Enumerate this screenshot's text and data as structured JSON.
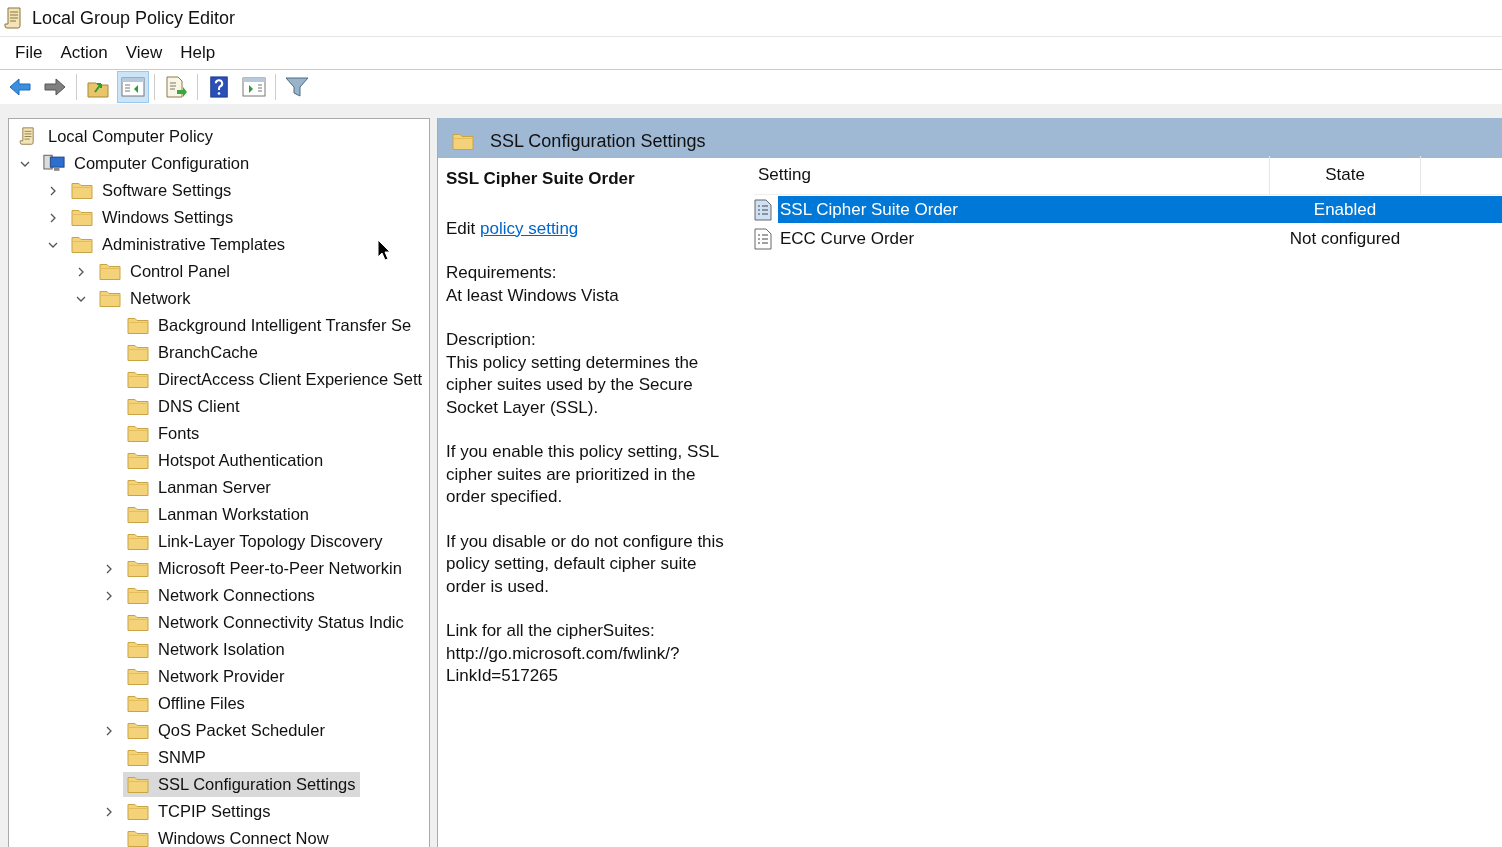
{
  "window": {
    "title": "Local Group Policy Editor"
  },
  "menu": [
    "File",
    "Action",
    "View",
    "Help"
  ],
  "toolbar": [
    {
      "kind": "back",
      "pressed": false
    },
    {
      "kind": "forward",
      "pressed": false
    },
    {
      "kind": "sep"
    },
    {
      "kind": "up",
      "pressed": false
    },
    {
      "kind": "tree",
      "pressed": true
    },
    {
      "kind": "sep"
    },
    {
      "kind": "export",
      "pressed": false
    },
    {
      "kind": "sep"
    },
    {
      "kind": "help",
      "pressed": false
    },
    {
      "kind": "action",
      "pressed": false
    },
    {
      "kind": "sep"
    },
    {
      "kind": "filter",
      "pressed": false
    }
  ],
  "tree": [
    {
      "label": "Local Computer Policy",
      "kind": "root",
      "selected": false,
      "children": [
        {
          "label": "Computer Configuration",
          "kind": "computer",
          "expandable": true,
          "expanded": true,
          "selected": false,
          "children": [
            {
              "label": "Software Settings",
              "kind": "folder",
              "expandable": true,
              "expanded": false,
              "selected": false
            },
            {
              "label": "Windows Settings",
              "kind": "folder",
              "expandable": true,
              "expanded": false,
              "selected": false
            },
            {
              "label": "Administrative Templates",
              "kind": "folder",
              "expandable": true,
              "expanded": true,
              "selected": false,
              "children": [
                {
                  "label": "Control Panel",
                  "kind": "folder",
                  "expandable": true,
                  "expanded": false,
                  "selected": false
                },
                {
                  "label": "Network",
                  "kind": "folder",
                  "expandable": true,
                  "expanded": true,
                  "selected": false,
                  "children": [
                    {
                      "label": "Background Intelligent Transfer Se",
                      "kind": "folder",
                      "expandable": false,
                      "selected": false
                    },
                    {
                      "label": "BranchCache",
                      "kind": "folder",
                      "expandable": false,
                      "selected": false
                    },
                    {
                      "label": "DirectAccess Client Experience Sett",
                      "kind": "folder",
                      "expandable": false,
                      "selected": false
                    },
                    {
                      "label": "DNS Client",
                      "kind": "folder",
                      "expandable": false,
                      "selected": false
                    },
                    {
                      "label": "Fonts",
                      "kind": "folder",
                      "expandable": false,
                      "selected": false
                    },
                    {
                      "label": "Hotspot Authentication",
                      "kind": "folder",
                      "expandable": false,
                      "selected": false
                    },
                    {
                      "label": "Lanman Server",
                      "kind": "folder",
                      "expandable": false,
                      "selected": false
                    },
                    {
                      "label": "Lanman Workstation",
                      "kind": "folder",
                      "expandable": false,
                      "selected": false
                    },
                    {
                      "label": "Link-Layer Topology Discovery",
                      "kind": "folder",
                      "expandable": false,
                      "selected": false
                    },
                    {
                      "label": "Microsoft Peer-to-Peer Networkin",
                      "kind": "folder",
                      "expandable": true,
                      "expanded": false,
                      "selected": false
                    },
                    {
                      "label": "Network Connections",
                      "kind": "folder",
                      "expandable": true,
                      "expanded": false,
                      "selected": false
                    },
                    {
                      "label": "Network Connectivity Status Indic",
                      "kind": "folder",
                      "expandable": false,
                      "selected": false
                    },
                    {
                      "label": "Network Isolation",
                      "kind": "folder",
                      "expandable": false,
                      "selected": false
                    },
                    {
                      "label": "Network Provider",
                      "kind": "folder",
                      "expandable": false,
                      "selected": false
                    },
                    {
                      "label": "Offline Files",
                      "kind": "folder",
                      "expandable": false,
                      "selected": false
                    },
                    {
                      "label": "QoS Packet Scheduler",
                      "kind": "folder",
                      "expandable": true,
                      "expanded": false,
                      "selected": false
                    },
                    {
                      "label": "SNMP",
                      "kind": "folder",
                      "expandable": false,
                      "selected": false
                    },
                    {
                      "label": "SSL Configuration Settings",
                      "kind": "folder",
                      "expandable": false,
                      "selected": true
                    },
                    {
                      "label": "TCPIP Settings",
                      "kind": "folder",
                      "expandable": true,
                      "expanded": false,
                      "selected": false
                    },
                    {
                      "label": "Windows Connect Now",
                      "kind": "folder",
                      "expandable": false,
                      "selected": false
                    }
                  ]
                }
              ]
            }
          ]
        }
      ]
    }
  ],
  "details": {
    "header": "SSL Configuration Settings",
    "title": "SSL Cipher Suite Order",
    "edit_prefix": "Edit",
    "edit_link": "policy setting",
    "paragraphs": [
      "Requirements:\nAt least Windows Vista",
      "Description:\nThis policy setting determines the cipher suites used by the Secure Socket Layer (SSL).",
      "If you enable this policy setting, SSL cipher suites are prioritized in the order specified.",
      "If you disable or do not configure this policy setting, default cipher suite order is used.",
      "Link for all the cipherSuites:\nhttp://go.microsoft.com/fwlink/?\nLinkId=517265"
    ]
  },
  "table": {
    "columns": [
      "Setting",
      "State"
    ],
    "rows": [
      {
        "setting": "SSL Cipher Suite Order",
        "state": "Enabled",
        "selected": true
      },
      {
        "setting": "ECC Curve Order",
        "state": "Not configured",
        "selected": false
      }
    ]
  }
}
